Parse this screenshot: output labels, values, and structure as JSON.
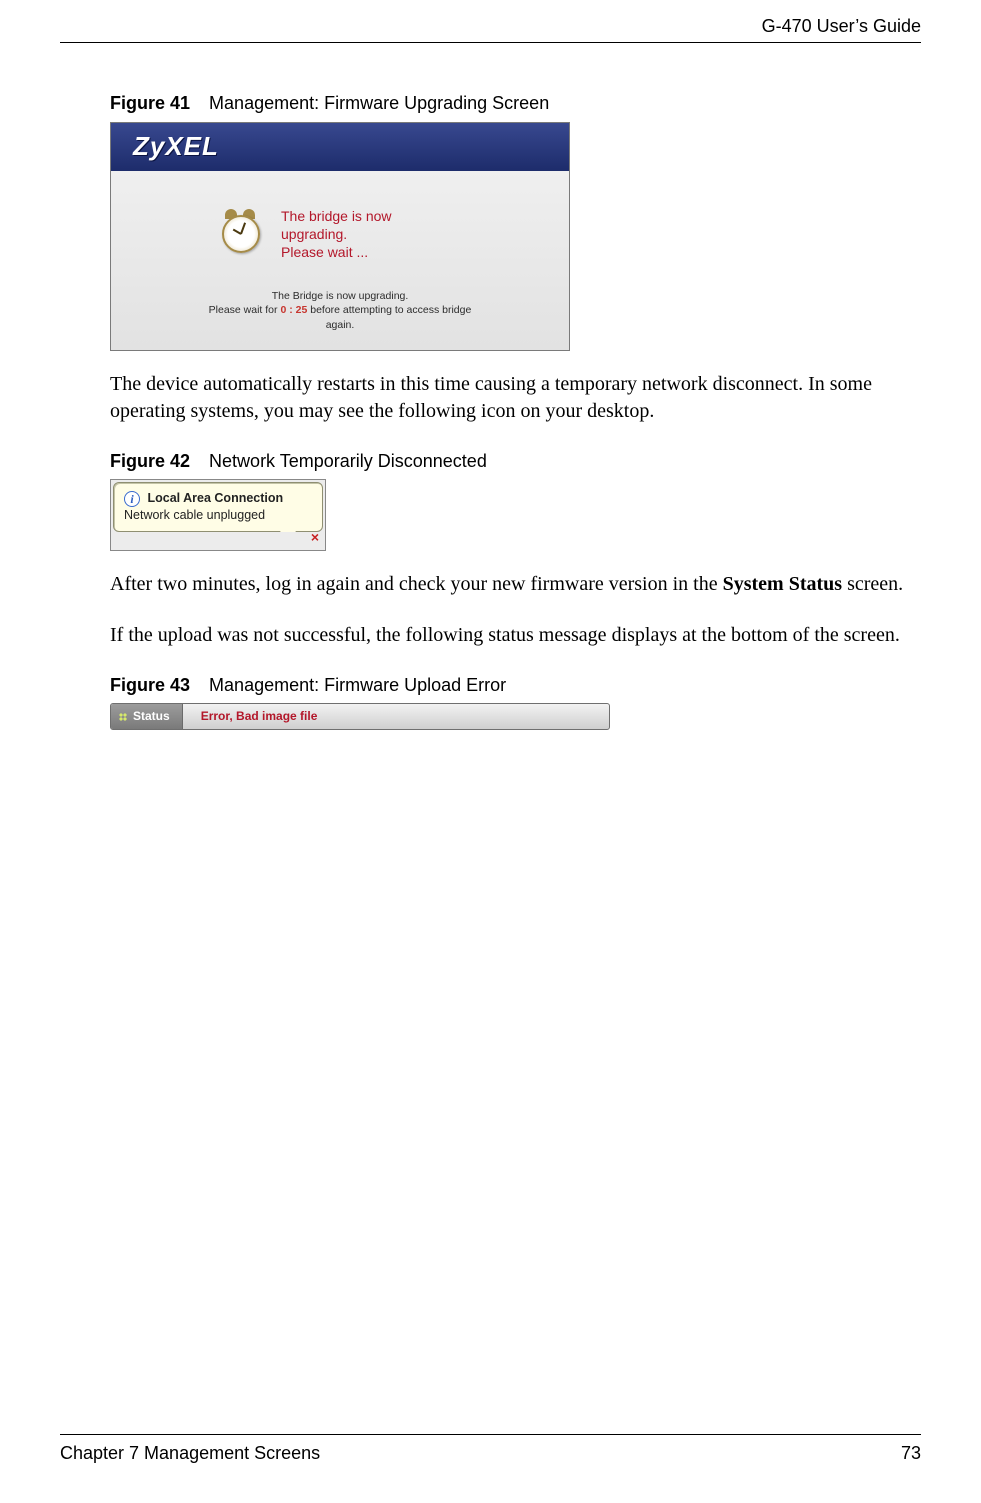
{
  "header": {
    "guide_title": "G-470 User’s Guide"
  },
  "figures": {
    "fig41": {
      "label": "Figure 41",
      "caption": "Management: Firmware Upgrading Screen",
      "brand": "ZyXEL",
      "red_line1": "The bridge is now",
      "red_line2": "upgrading.",
      "red_line3": "Please wait ...",
      "small_line1": "The Bridge is now upgrading.",
      "small_prefix": "Please wait for ",
      "small_time": "0 : 25",
      "small_suffix": " before attempting to access bridge",
      "small_line3": "again."
    },
    "fig42": {
      "label": "Figure 42",
      "caption": "Network Temporarily Disconnected",
      "balloon_title": "Local Area Connection",
      "balloon_body": "Network cable unplugged"
    },
    "fig43": {
      "label": "Figure 43",
      "caption": "Management: Firmware Upload Error",
      "status_label": "Status",
      "error_text": "Error, Bad image file"
    }
  },
  "paragraphs": {
    "p1": "The device automatically restarts in this time causing a temporary network disconnect. In some operating systems, you may see the following icon on your desktop.",
    "p2_a": "After two minutes, log in again and check your new firmware version in the ",
    "p2_bold": "System Status",
    "p2_b": " screen.",
    "p3": "If the upload was not successful, the following status message displays at the bottom of the screen."
  },
  "footer": {
    "chapter": "Chapter 7 Management Screens",
    "page_number": "73"
  }
}
